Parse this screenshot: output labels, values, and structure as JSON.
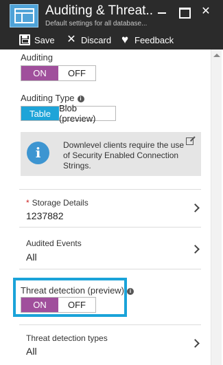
{
  "header": {
    "title": "Auditing & Threat...",
    "subtitle": "Default settings for all database...",
    "background": "#2b2b2b"
  },
  "toolbar": {
    "save_label": "Save",
    "discard_label": "Discard",
    "feedback_label": "Feedback"
  },
  "auditing": {
    "label": "Auditing",
    "on_label": "ON",
    "off_label": "OFF",
    "selected": "ON"
  },
  "auditing_type": {
    "label": "Auditing Type",
    "table_label": "Table",
    "blob_label": "Blob (preview)",
    "selected": "Table"
  },
  "info": {
    "text": "Downlevel clients require the use of Security Enabled Connection Strings."
  },
  "storage": {
    "required_mark": "*",
    "label": "Storage Details",
    "value": "1237882"
  },
  "audited_events": {
    "label": "Audited Events",
    "value": "All"
  },
  "threat_detection": {
    "label": "Threat detection (preview)",
    "on_label": "ON",
    "off_label": "OFF",
    "selected": "ON"
  },
  "threat_types": {
    "label": "Threat detection types",
    "value": "All"
  },
  "colors": {
    "accent_on": "#a04f9c",
    "accent_table": "#1ea4d8",
    "highlight": "#1aa3d9"
  }
}
